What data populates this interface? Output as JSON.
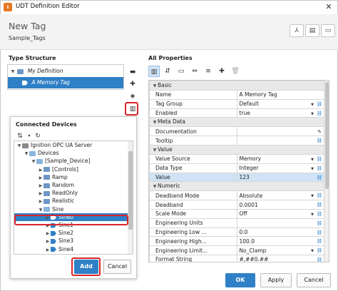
{
  "window": {
    "title": "UDT Definition Editor",
    "title_icon": "ignition-logo-icon",
    "accent": "#e87722"
  },
  "header": {
    "title": "New Tag",
    "subtitle": "Sample_Tags"
  },
  "type_structure": {
    "label": "Type Structure",
    "items": [
      {
        "label": "My Definition",
        "icon": "definition-icon"
      },
      {
        "label": "A Memory Tag",
        "icon": "memory-tag-icon",
        "selected": true
      }
    ]
  },
  "connected_devices": {
    "label": "Connected Devices",
    "items": [
      {
        "label": "Ignition OPC UA Server",
        "indent": 0
      },
      {
        "label": "Devices",
        "indent": 1
      },
      {
        "label": "[Sample_Device]",
        "indent": 2
      },
      {
        "label": "[Controls]",
        "indent": 3
      },
      {
        "label": "Ramp",
        "indent": 3
      },
      {
        "label": "Random",
        "indent": 3
      },
      {
        "label": "ReadOnly",
        "indent": 3
      },
      {
        "label": "Realistic",
        "indent": 3
      },
      {
        "label": "Sine",
        "indent": 3
      },
      {
        "label": "Sine0",
        "indent": 4,
        "selected": true
      },
      {
        "label": "Sine1",
        "indent": 4
      },
      {
        "label": "Sine2",
        "indent": 4
      },
      {
        "label": "Sine3",
        "indent": 4
      },
      {
        "label": "Sine4",
        "indent": 4
      }
    ],
    "add_label": "Add",
    "cancel_label": "Cancel"
  },
  "all_properties": {
    "label": "All Properties",
    "rows": [
      {
        "group": "Basic"
      },
      {
        "name": "Name",
        "value": "A Memory Tag"
      },
      {
        "name": "Tag Group",
        "value": "Default",
        "dropdown": true
      },
      {
        "name": "Enabled",
        "value": "true",
        "dropdown": true
      },
      {
        "group": "Meta Data"
      },
      {
        "name": "Documentation",
        "value": "",
        "edit": true
      },
      {
        "name": "Tooltip",
        "value": ""
      },
      {
        "group": "Value"
      },
      {
        "name": "Value Source",
        "value": "Memory",
        "dropdown": true
      },
      {
        "name": "Data Type",
        "value": "Integer",
        "dropdown": true
      },
      {
        "name": "Value",
        "value": "123",
        "highlight": true
      },
      {
        "group": "Numeric"
      },
      {
        "name": "Deadband Mode",
        "value": "Absolute",
        "dropdown": true
      },
      {
        "name": "Deadband",
        "value": "0.0001"
      },
      {
        "name": "Scale Mode",
        "value": "Off",
        "dropdown": true
      },
      {
        "name": "Engineering Units",
        "value": ""
      },
      {
        "name": "Engineering Low ...",
        "value": "0.0"
      },
      {
        "name": "Engineering High...",
        "value": "100.0"
      },
      {
        "name": "Engineering Limit...",
        "value": "No_Clamp",
        "dropdown": true
      },
      {
        "name": "Format String",
        "value": "#,##0.##"
      }
    ]
  },
  "footer": {
    "ok_label": "OK",
    "apply_label": "Apply",
    "cancel_label": "Cancel"
  },
  "colors": {
    "selection": "#2f80c6",
    "highlight_box": "#d9262b"
  }
}
